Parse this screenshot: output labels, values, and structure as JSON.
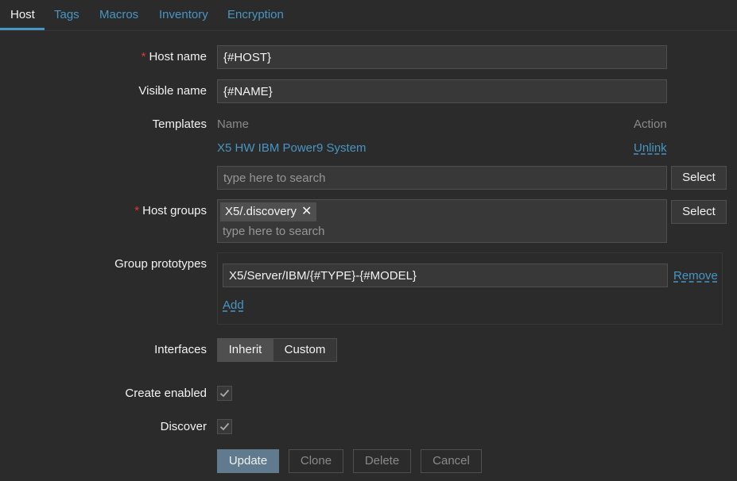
{
  "tabs": [
    {
      "label": "Host",
      "active": true
    },
    {
      "label": "Tags",
      "active": false
    },
    {
      "label": "Macros",
      "active": false
    },
    {
      "label": "Inventory",
      "active": false
    },
    {
      "label": "Encryption",
      "active": false
    }
  ],
  "form": {
    "host_name": {
      "label": "Host name",
      "required_mark": "*",
      "value": "{#HOST}"
    },
    "visible_name": {
      "label": "Visible name",
      "value": "{#NAME}"
    },
    "templates": {
      "label": "Templates",
      "col_name": "Name",
      "col_action": "Action",
      "items": [
        {
          "name": "X5 HW IBM Power9 System",
          "action": "Unlink"
        }
      ],
      "search_placeholder": "type here to search",
      "select_label": "Select"
    },
    "host_groups": {
      "label": "Host groups",
      "required_mark": "*",
      "chips": [
        {
          "label": "X5/.discovery",
          "remove_icon": "close-icon"
        }
      ],
      "search_placeholder": "type here to search",
      "select_label": "Select"
    },
    "group_prototypes": {
      "label": "Group prototypes",
      "items": [
        {
          "value": "X5/Server/IBM/{#TYPE}-{#MODEL}",
          "remove_label": "Remove"
        }
      ],
      "add_label": "Add"
    },
    "interfaces": {
      "label": "Interfaces",
      "options": [
        "Inherit",
        "Custom"
      ],
      "selected": "Inherit"
    },
    "create_enabled": {
      "label": "Create enabled",
      "checked": true
    },
    "discover": {
      "label": "Discover",
      "checked": true
    }
  },
  "actions": {
    "update": "Update",
    "clone": "Clone",
    "delete": "Delete",
    "cancel": "Cancel"
  },
  "colors": {
    "background": "#2b2b2b",
    "link": "#4796c4",
    "required": "#e33734",
    "primary_button": "#5f7b8d"
  }
}
